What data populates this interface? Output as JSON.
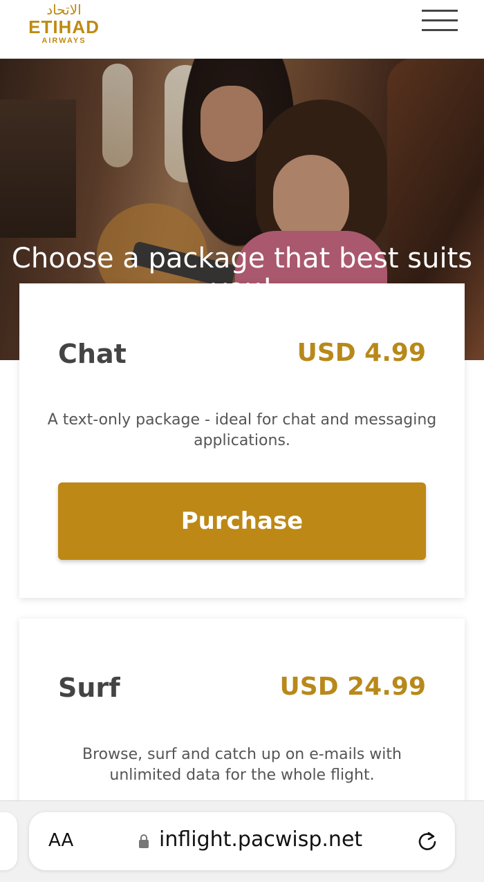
{
  "header": {
    "logo": {
      "arabic": "الاتحاد",
      "main": "ETIHAD",
      "sub": "AIRWAYS"
    },
    "menu_icon": "hamburger-menu-icon"
  },
  "hero": {
    "title": "Choose a package that best suits you!"
  },
  "packages": [
    {
      "name": "Chat",
      "price": "USD 4.99",
      "description": "A text-only package - ideal for chat and messaging applications.",
      "button_label": "Purchase"
    },
    {
      "name": "Surf",
      "price": "USD 24.99",
      "description": "Browse, surf and catch up on e-mails with unlimited data for the whole flight."
    }
  ],
  "browser": {
    "text_size_label": "AA",
    "url": "inflight.pacwisp.net",
    "lock_icon": "lock-icon",
    "reload_icon": "reload-icon"
  },
  "colors": {
    "brand_gold": "#bd8815",
    "price_gold": "#b8891a",
    "text_dark": "#444444"
  }
}
